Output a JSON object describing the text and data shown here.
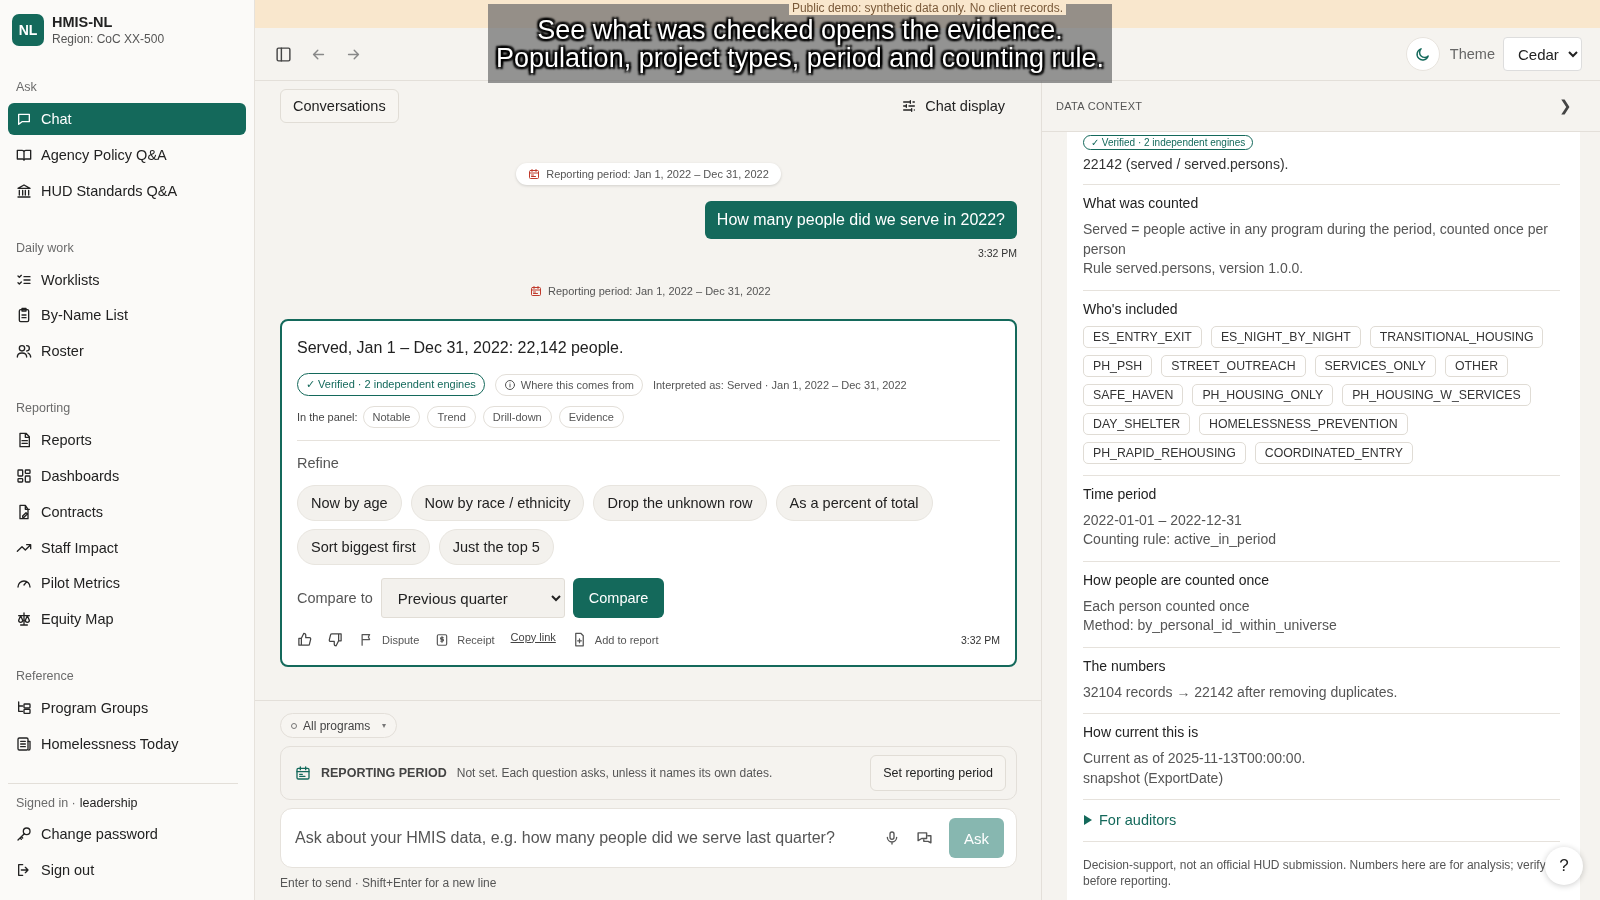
{
  "banner": {
    "text": "Public demo: synthetic data only. No client records."
  },
  "caption": {
    "lines": [
      "See what was checked opens the evidence.",
      "Population, project types, period and counting rule."
    ]
  },
  "sidebar": {
    "brand": {
      "initials": "NL",
      "title": "HMIS-NL",
      "subtitle": "Region: CoC XX-500"
    },
    "sections": [
      {
        "heading": "Ask",
        "items": [
          {
            "label": "Chat",
            "selected": true
          },
          {
            "label": "Agency Policy Q&A",
            "selected": false
          },
          {
            "label": "HUD Standards Q&A",
            "selected": false
          }
        ]
      },
      {
        "heading": "Daily work",
        "items": [
          {
            "label": "Worklists",
            "selected": false
          },
          {
            "label": "By-Name List",
            "selected": false
          },
          {
            "label": "Roster",
            "selected": false
          }
        ]
      },
      {
        "heading": "Reporting",
        "items": [
          {
            "label": "Reports",
            "selected": false
          },
          {
            "label": "Dashboards",
            "selected": false
          },
          {
            "label": "Contracts",
            "selected": false
          },
          {
            "label": "Staff Impact",
            "selected": false
          },
          {
            "label": "Pilot Metrics",
            "selected": false
          },
          {
            "label": "Equity Map",
            "selected": false
          }
        ]
      },
      {
        "heading": "Reference",
        "items": [
          {
            "label": "Program Groups",
            "selected": false
          },
          {
            "label": "Homelessness Today",
            "selected": false
          }
        ]
      }
    ],
    "account": {
      "signed_in": "Signed in ·",
      "user": "leadership",
      "actions": [
        "Change password",
        "Sign out"
      ]
    }
  },
  "toolbar": {
    "theme_label": "Theme",
    "theme": "Cedar"
  },
  "chat": {
    "conversations_button": "Conversations",
    "display_button": "Chat display",
    "period_chip": "Reporting period: Jan 1, 2022 – Dec 31, 2022",
    "user_message": {
      "text": "How many people did we serve in 2022?",
      "time": "3:32 PM"
    },
    "period_divider": "Reporting period: Jan 1, 2022 – Dec 31, 2022",
    "answer": {
      "headline": "Served, Jan 1 – Dec 31, 2022: 22,142 people.",
      "verified": "✓ Verified · 2 independent engines",
      "source_button": "Where this comes from",
      "interpreted": "Interpreted as: Served · Jan 1, 2022 – Dec 31, 2022",
      "panel_label": "In the panel:",
      "panel_chips": [
        "Notable",
        "Trend",
        "Drill-down",
        "Evidence"
      ],
      "refine_label": "Refine",
      "refine_chips": [
        "Now by age",
        "Now by race / ethnicity",
        "Drop the unknown row",
        "As a percent of total",
        "Sort biggest first",
        "Just the top 5"
      ],
      "compare_label": "Compare to",
      "compare_value": "Previous quarter",
      "compare_button": "Compare",
      "actions": {
        "dispute": "Dispute",
        "receipt": "Receipt",
        "copy_link": "Copy link",
        "add_to_report": "Add to report"
      },
      "time": "3:32 PM"
    }
  },
  "composer": {
    "program_chip": "All programs",
    "program_caret": "▾",
    "period_label": "REPORTING PERIOD",
    "period_note": "Not set. Each question asks, unless it names its own dates.",
    "period_button": "Set reporting period",
    "placeholder": "Ask about your HMIS data, e.g. how many people did we serve last quarter?",
    "ask_button": {
      "label": "Ask",
      "disabled": true
    },
    "hint": "Enter to send · Shift+Enter for a new line"
  },
  "context": {
    "title": "DATA CONTEXT",
    "collapse": "❯",
    "verified": "✓ Verified · 2 independent engines",
    "value": "22142 (served / served.persons).",
    "sections": [
      {
        "kind": "text",
        "title": "What was counted",
        "lines": [
          "Served = people active in any program during the period, counted once per person",
          "Rule served.persons, version 1.0.0."
        ]
      },
      {
        "kind": "tags",
        "title": "Who's included",
        "tags": [
          "ES_ENTRY_EXIT",
          "ES_NIGHT_BY_NIGHT",
          "TRANSITIONAL_HOUSING",
          "PH_PSH",
          "STREET_OUTREACH",
          "SERVICES_ONLY",
          "OTHER",
          "SAFE_HAVEN",
          "PH_HOUSING_ONLY",
          "PH_HOUSING_W_SERVICES",
          "DAY_SHELTER",
          "HOMELESSNESS_PREVENTION",
          "PH_RAPID_REHOUSING",
          "COORDINATED_ENTRY"
        ]
      },
      {
        "kind": "text",
        "title": "Time period",
        "lines": [
          "2022-01-01 – 2022-12-31",
          "Counting rule: active_in_period"
        ]
      },
      {
        "kind": "text",
        "title": "How people are counted once",
        "lines": [
          "Each person counted once",
          "Method: by_personal_id_within_universe"
        ]
      },
      {
        "kind": "text",
        "title": "The numbers",
        "lines": [
          "32104 records → 22142 after removing duplicates."
        ]
      },
      {
        "kind": "text",
        "title": "How current this is",
        "lines": [
          "Current as of 2025-11-13T00:00:00.",
          "snapshot (ExportDate)"
        ]
      }
    ],
    "auditors": {
      "label": "For auditors",
      "expanded": false
    },
    "disclaimer": "Decision-support, not an official HUD submission. Numbers here are for analysis; verify before reporting.",
    "help": "?"
  }
}
